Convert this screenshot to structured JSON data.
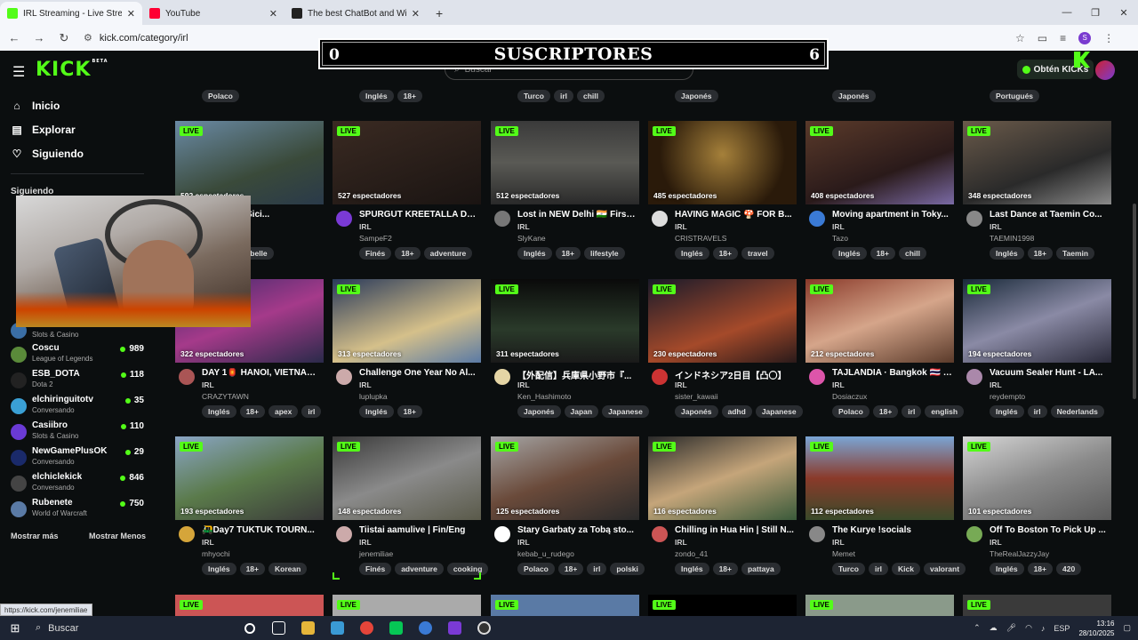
{
  "browser": {
    "tabs": [
      {
        "title": "IRL Streaming - Live Streams on Kick",
        "color": "#0f1012",
        "active": true
      },
      {
        "title": "YouTube",
        "color": "#ff0033",
        "active": false
      },
      {
        "title": "The best ChatBot and Widgets",
        "color": "#222",
        "active": false
      }
    ],
    "url": "kick.com/category/irl",
    "profile_initial": "S"
  },
  "header": {
    "logo": "KICK",
    "beta": "BETA",
    "search_placeholder": "Buscar",
    "get_kicks": "Obtén KICKs"
  },
  "overlay": {
    "left": "0",
    "center": "SUSCRIPTORES",
    "right": "6"
  },
  "sidebar": {
    "nav": [
      {
        "label": "Inicio",
        "icon": "⌂"
      },
      {
        "label": "Explorar",
        "icon": "▤"
      },
      {
        "label": "Siguiendo",
        "icon": "♡"
      }
    ],
    "following_title": "Siguiendo",
    "channels": [
      {
        "name": "",
        "category": "Slots & Casino",
        "viewers": "",
        "color": "#3a6ea5"
      },
      {
        "name": "Coscu",
        "category": "League of Legends",
        "viewers": "989",
        "color": "#5a8a3a"
      },
      {
        "name": "ESB_DOTA",
        "category": "Dota 2",
        "viewers": "118",
        "color": "#222"
      },
      {
        "name": "elchiringuitotv",
        "category": "Conversando",
        "viewers": "35",
        "color": "#3aa0d5"
      },
      {
        "name": "Casiibro",
        "category": "Slots & Casino",
        "viewers": "110",
        "color": "#6a3ad5"
      },
      {
        "name": "NewGamePlusOK",
        "category": "Conversando",
        "viewers": "29",
        "color": "#1a2a6a"
      },
      {
        "name": "elchiclekick",
        "category": "Conversando",
        "viewers": "846",
        "color": "#444"
      },
      {
        "name": "Rubenete",
        "category": "World of Warcraft",
        "viewers": "750",
        "color": "#5a7aa5"
      }
    ],
    "show_more": "Mostrar más",
    "show_less": "Mostrar Menos"
  },
  "top_tags": [
    [
      "Polaco"
    ],
    [
      "Inglés",
      "18+"
    ],
    [
      "Turco",
      "irl",
      "chill"
    ],
    [
      "Japonés"
    ],
    [
      "Japonés"
    ],
    [
      "Portugués"
    ]
  ],
  "live_label": "LIVE",
  "cards": [
    {
      "views": "592 espectadores",
      "title": "Malte ! En Sici...",
      "category": "IRL",
      "streamer": "",
      "tags": [
        "bot",
        "Poubelle"
      ],
      "bg": "linear-gradient(160deg,#6a8aa5,#3a4a3a 60%,#2a3a4a)",
      "av": "#c55"
    },
    {
      "views": "527 espectadores",
      "title": "SPURGUT KREETALLA DA...",
      "category": "IRL",
      "streamer": "SampeF2",
      "tags": [
        "Finés",
        "18+",
        "adventure"
      ],
      "bg": "linear-gradient(160deg,#3a2a22,#1a1412)",
      "av": "#7a3ad5"
    },
    {
      "views": "512 espectadores",
      "title": "Lost in NEW Delhi 🇮🇳 First ...",
      "category": "IRL",
      "streamer": "SlyKane",
      "tags": [
        "Inglés",
        "18+",
        "lifestyle"
      ],
      "bg": "linear-gradient(180deg,#3a3a3a,#5a5a55 50%,#2a2a2a)",
      "av": "#777"
    },
    {
      "views": "485 espectadores",
      "title": "HAVING MAGIC 🍄 FOR B...",
      "category": "IRL",
      "streamer": "CRISTRAVELS",
      "tags": [
        "Inglés",
        "18+",
        "travel"
      ],
      "bg": "radial-gradient(circle at 50% 40%,#a5803a,#2a1a0a 70%)",
      "av": "#ddd"
    },
    {
      "views": "408 espectadores",
      "title": "Moving apartment in Toky...",
      "category": "IRL",
      "streamer": "Tazo",
      "tags": [
        "Inglés",
        "18+",
        "chill"
      ],
      "bg": "linear-gradient(160deg,#5a3a2a,#2a1a1a 60%,#7a6aa5)",
      "av": "#3a7ad5"
    },
    {
      "views": "348 espectadores",
      "title": "Last Dance at Taemin Co...",
      "category": "IRL",
      "streamer": "TAEMIN1998",
      "tags": [
        "Inglés",
        "18+",
        "Taemin"
      ],
      "bg": "linear-gradient(160deg,#6a5a4a,#2a2a2a 60%,#8a8a8a)",
      "av": "#888"
    },
    {
      "views": "322 espectadores",
      "title": "DAY 1🏮 HANOI, VIETNAM ...",
      "category": "IRL",
      "streamer": "CRAZYTAWN",
      "tags": [
        "Inglés",
        "18+",
        "apex",
        "irl"
      ],
      "bg": "linear-gradient(160deg,#3a2a6a,#a53a8a 50%,#2a2a4a)",
      "av": "#a55"
    },
    {
      "views": "313 espectadores",
      "title": "Challenge One Year No Al...",
      "category": "IRL",
      "streamer": "luplupka",
      "tags": [
        "Inglés",
        "18+"
      ],
      "bg": "linear-gradient(160deg,#2a3a5a,#d5c08a 60%,#5a7aa5)",
      "av": "#caa"
    },
    {
      "views": "311 espectadores",
      "title": "【外配信】兵庫県小野市『...",
      "category": "IRL",
      "streamer": "Ken_Hashimoto",
      "tags": [
        "Japonés",
        "Japan",
        "Japanese"
      ],
      "bg": "linear-gradient(180deg,#0a0a0a,#2a3a2a 60%,#1a1a1a)",
      "av": "#e5d5a5"
    },
    {
      "views": "230 espectadores",
      "title": "インドネシア2日目【凸〇】",
      "category": "IRL",
      "streamer": "sister_kawaii",
      "tags": [
        "Japonés",
        "adhd",
        "Japanese"
      ],
      "bg": "linear-gradient(160deg,#1a1a2a,#a54a2a 60%,#2a1a1a)",
      "av": "#c33"
    },
    {
      "views": "212 espectadores",
      "title": "TAJLANDIA · Bangkok 🇹🇭 -...",
      "category": "IRL",
      "streamer": "Dosiaczux",
      "tags": [
        "Polaco",
        "18+",
        "irl",
        "english"
      ],
      "bg": "linear-gradient(160deg,#8a3a2a,#d5a58a 50%,#5a3a2a)",
      "av": "#d5a"
    },
    {
      "views": "194 espectadores",
      "title": "Vacuum Sealer Hunt - LA...",
      "category": "IRL",
      "streamer": "reydempto",
      "tags": [
        "Inglés",
        "irl",
        "Nederlands"
      ],
      "bg": "linear-gradient(160deg,#1a2a3a,#8a8aa5 50%,#2a2a3a)",
      "av": "#a8a"
    },
    {
      "views": "193 espectadores",
      "title": "🛺Day7 TUKTUK TOURN...",
      "category": "IRL",
      "streamer": "mhyochi",
      "tags": [
        "Inglés",
        "18+",
        "Korean"
      ],
      "bg": "linear-gradient(160deg,#8aa5c5,#5a7a4a 50%,#3a3a3a)",
      "av": "#d5a53a"
    },
    {
      "views": "148 espectadores",
      "title": "Tiistai aamulive | Fin/Eng",
      "category": "IRL",
      "streamer": "jenemiliae",
      "tags": [
        "Finés",
        "adventure",
        "cooking"
      ],
      "bg": "linear-gradient(160deg,#3a3a3a,#8a8a8a 50%,#5a5a4a)",
      "av": "#caa"
    },
    {
      "views": "125 espectadores",
      "title": "Stary Garbaty za Tobą sto...",
      "category": "IRL",
      "streamer": "kebab_u_rudego",
      "tags": [
        "Polaco",
        "18+",
        "irl",
        "polski"
      ],
      "bg": "linear-gradient(160deg,#a5a5a5,#6a4a3a 50%,#2a2a2a)",
      "av": "#fff"
    },
    {
      "views": "116 espectadores",
      "title": "Chilling in Hua Hin | Still N...",
      "category": "IRL",
      "streamer": "zondo_41",
      "tags": [
        "Inglés",
        "18+",
        "pattaya"
      ],
      "bg": "linear-gradient(160deg,#2a2a2a,#c5a57a 50%,#3a5a3a)",
      "av": "#c55"
    },
    {
      "views": "112 espectadores",
      "title": "The Kurye !socials",
      "category": "IRL",
      "streamer": "Memet",
      "tags": [
        "Turco",
        "irl",
        "Kick",
        "valorant"
      ],
      "bg": "linear-gradient(180deg,#7aa5d5,#8a3a2a 50%,#3a4a2a)",
      "av": "#888"
    },
    {
      "views": "101 espectadores",
      "title": "Off To Boston To Pick Up ...",
      "category": "IRL",
      "streamer": "TheRealJazzyJay",
      "tags": [
        "Inglés",
        "18+",
        "420"
      ],
      "bg": "linear-gradient(160deg,#d5d5d5,#8a8a8a 50%,#5a5a5a)",
      "av": "#7a5"
    }
  ],
  "bottom_row_bg": [
    "#c55",
    "#aaa",
    "#5a7aa5",
    "#000",
    "#8a9a8a",
    "#3a3a3a"
  ],
  "status_url": "https://kick.com/jenemiliae",
  "taskbar": {
    "search": "Buscar",
    "lang": "ESP",
    "time": "13:16",
    "date": "28/10/2025"
  }
}
